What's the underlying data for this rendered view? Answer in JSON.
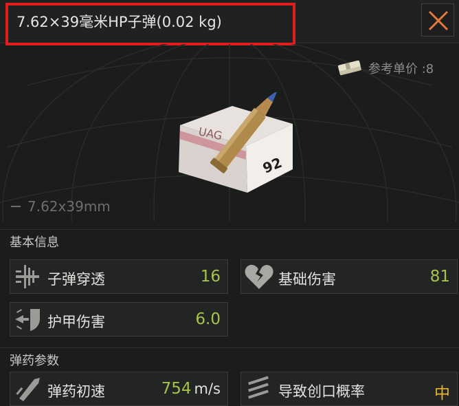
{
  "header": {
    "title": "7.62×39毫米HP子弹(0.02 kg)",
    "close_icon": "close-icon"
  },
  "price": {
    "label": "参考单价 :8",
    "icon": "money-stack-icon"
  },
  "preview": {
    "caliber": "7.62x39mm",
    "box_text_top": "UAG",
    "box_text_side": "92"
  },
  "basic_info": {
    "heading": "基本信息",
    "stats": [
      {
        "label": "子弹穿透",
        "value": "16",
        "icon": "penetration-icon"
      },
      {
        "label": "基础伤害",
        "value": "81",
        "icon": "broken-heart-icon"
      },
      {
        "label": "护甲伤害",
        "value": "6.0",
        "icon": "armor-damage-icon"
      }
    ]
  },
  "ammo_params": {
    "heading": "弹药参数",
    "stats": [
      {
        "label": "弹药初速",
        "value": "754",
        "unit": "m/s",
        "icon": "muzzle-velocity-icon"
      },
      {
        "label": "导致创口概率",
        "value": "中",
        "icon": "wound-chance-icon"
      }
    ]
  },
  "colors": {
    "highlight_red": "#e21d1d",
    "value_green": "#a8c24a",
    "value_orange": "#e8b52a",
    "close_orange": "#e07a3a"
  }
}
